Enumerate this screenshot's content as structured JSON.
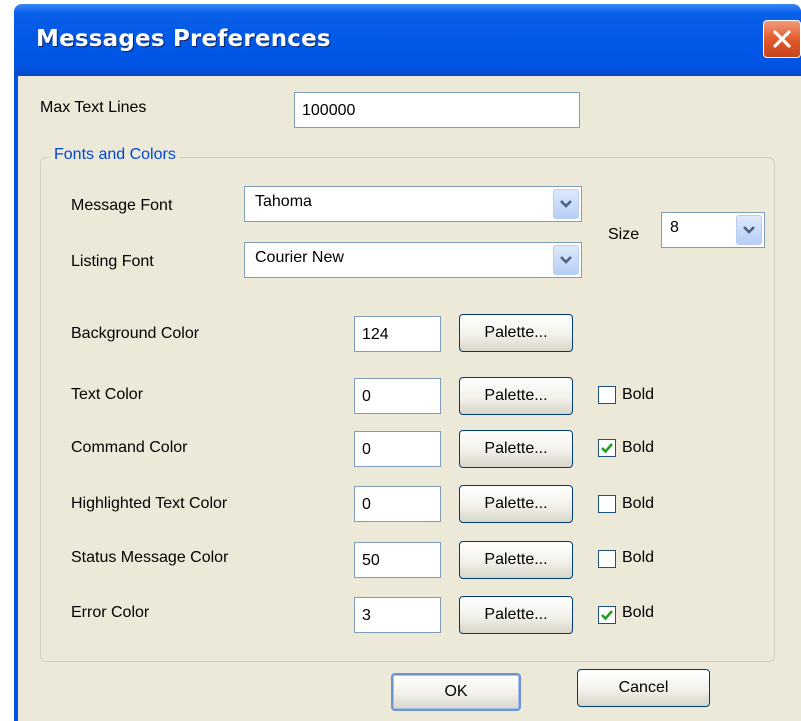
{
  "window": {
    "title": "Messages Preferences"
  },
  "max_text_lines": {
    "label": "Max Text Lines",
    "value": "100000"
  },
  "fonts_group": {
    "title": "Fonts and Colors"
  },
  "message_font": {
    "label": "Message Font",
    "value": "Tahoma"
  },
  "listing_font": {
    "label": "Listing Font",
    "value": "Courier New"
  },
  "size": {
    "label": "Size",
    "value": "8"
  },
  "palette_label": "Palette...",
  "bold_label": "Bold",
  "colors": [
    {
      "label": "Background Color",
      "value": "124",
      "bold": null
    },
    {
      "label": "Text Color",
      "value": "0",
      "bold": false
    },
    {
      "label": "Command Color",
      "value": "0",
      "bold": true
    },
    {
      "label": "Highlighted Text Color",
      "value": "0",
      "bold": false
    },
    {
      "label": "Status Message Color",
      "value": "50",
      "bold": false
    },
    {
      "label": "Error Color",
      "value": "3",
      "bold": true
    }
  ],
  "buttons": {
    "ok": "OK",
    "cancel": "Cancel"
  },
  "theme": {
    "titlebar": "#0054e3",
    "client": "#ece9d8",
    "group_title": "#0046d5",
    "check": "#21a121"
  }
}
